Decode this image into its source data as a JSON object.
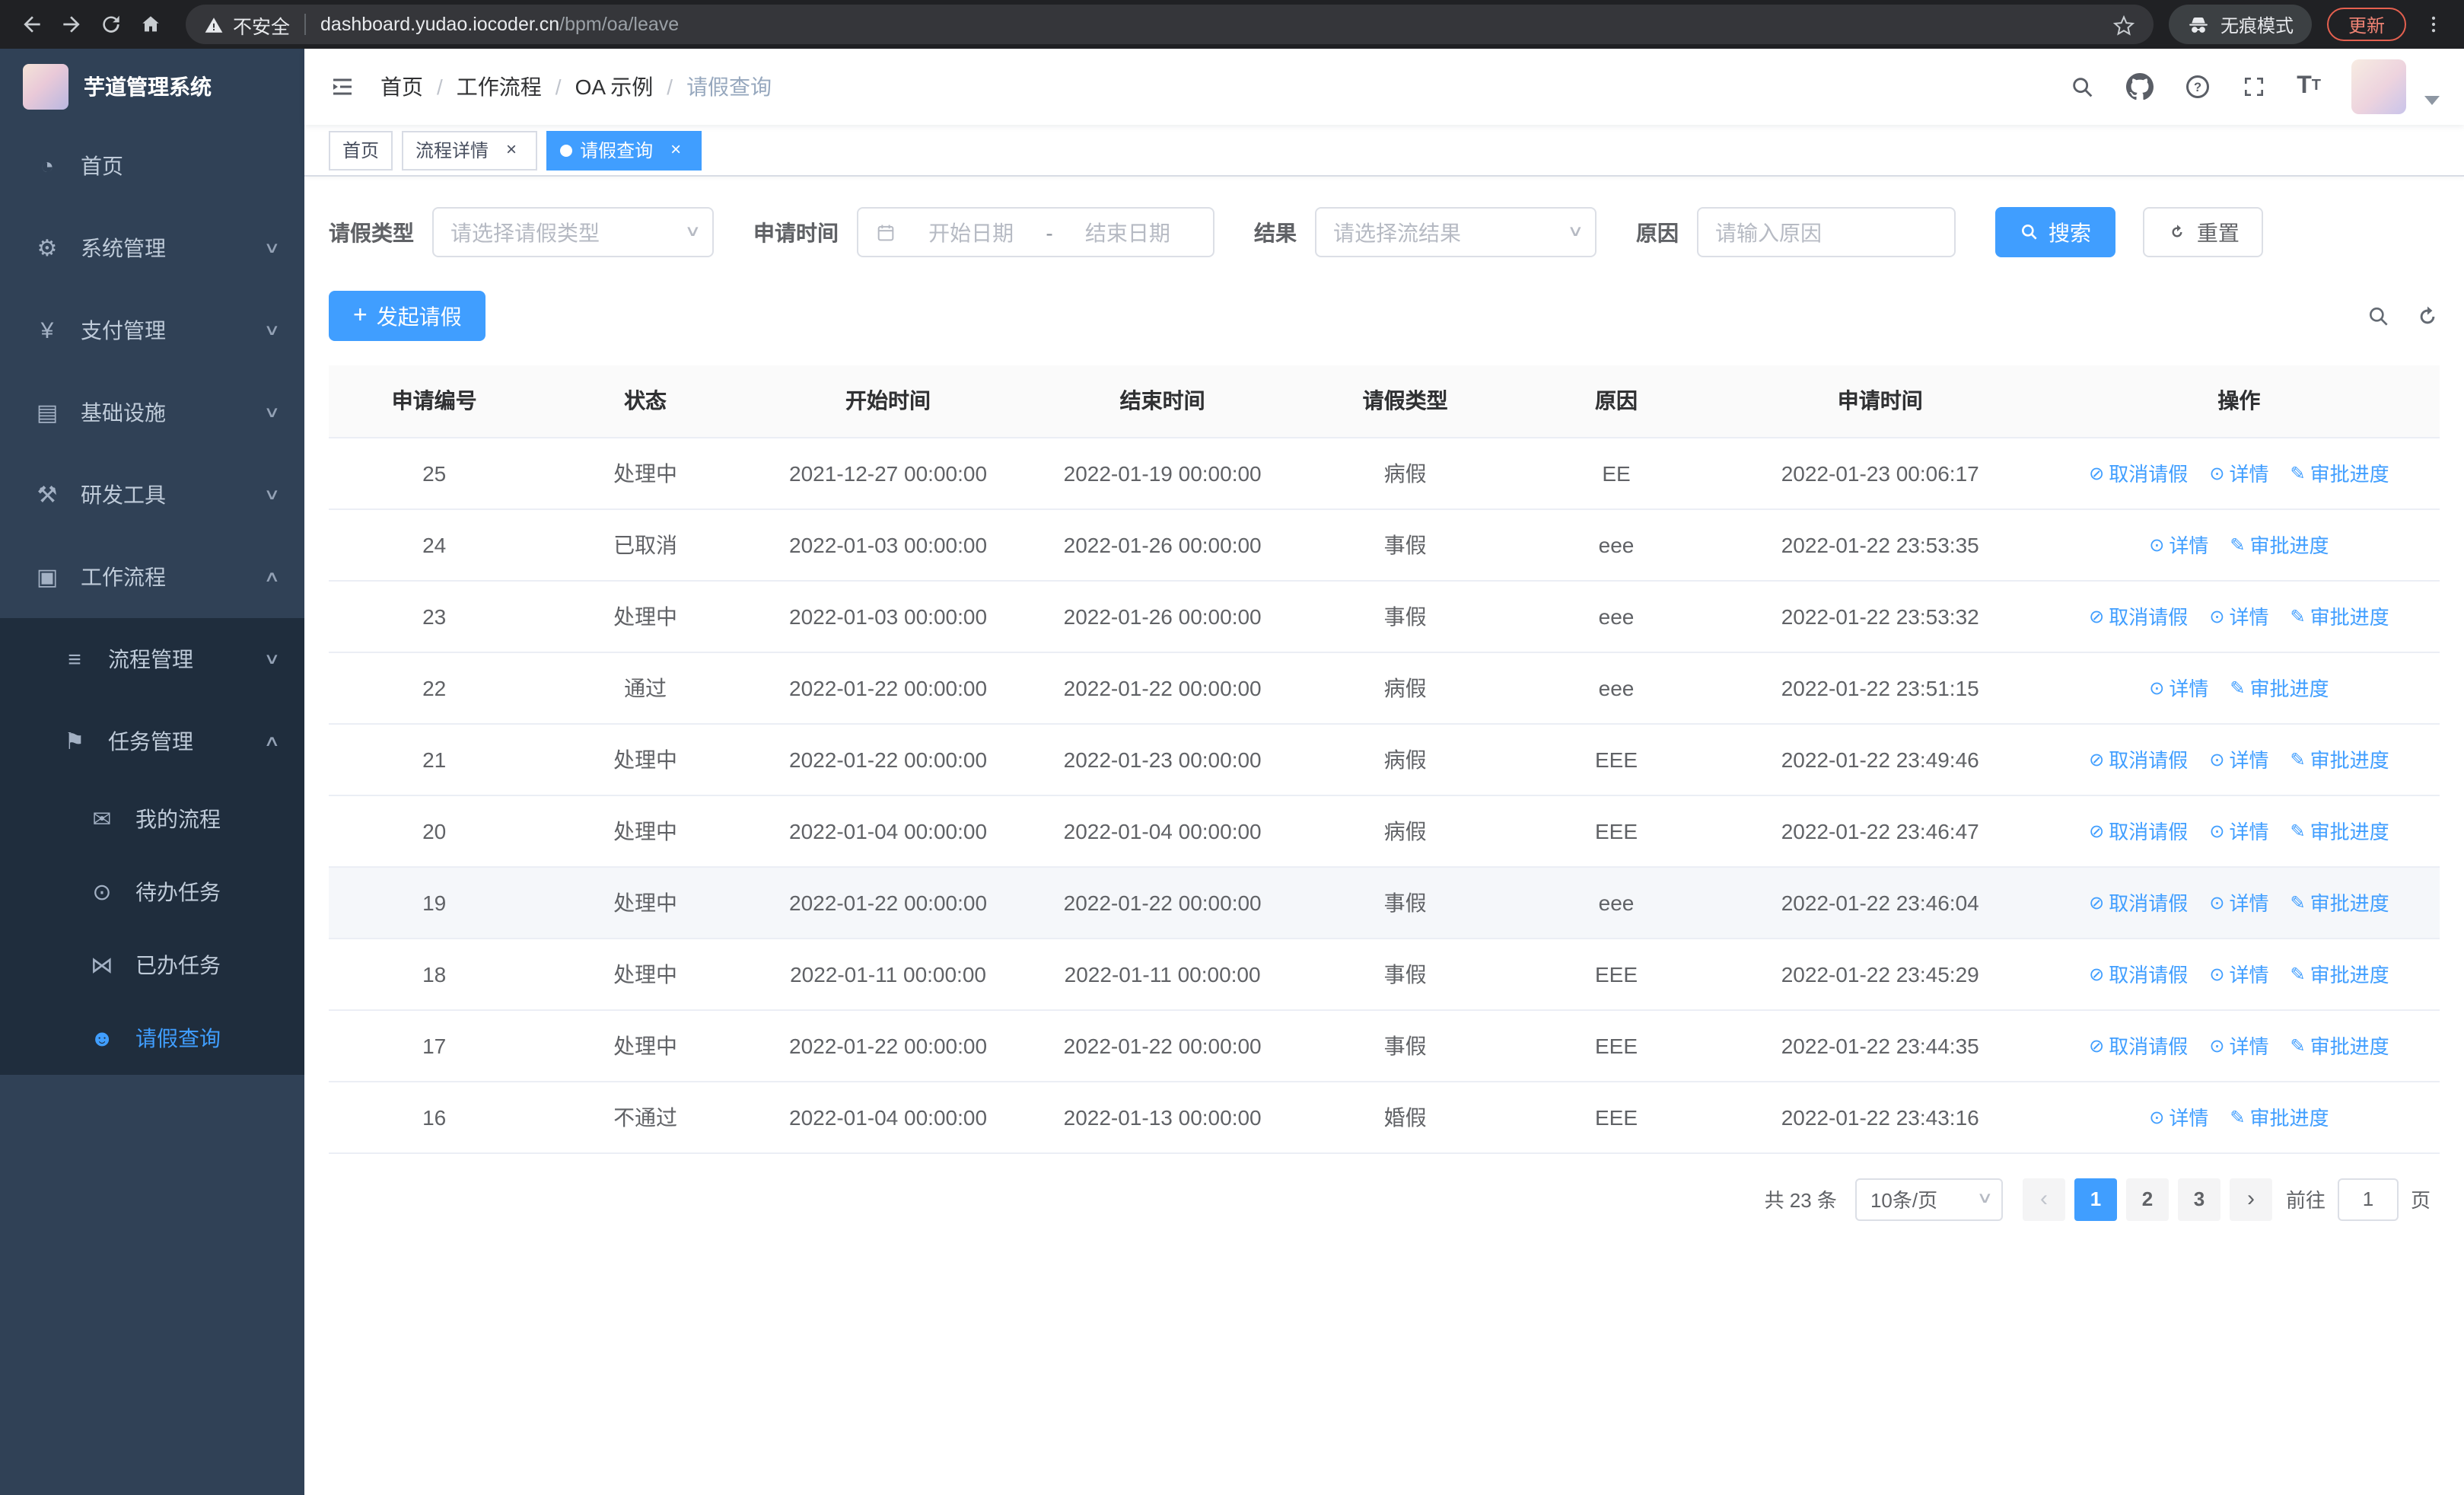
{
  "browser": {
    "security_label": "不安全",
    "url_domain": "dashboard.yudao.iocoder.cn",
    "url_path": "/bpm/oa/leave",
    "incognito_label": "无痕模式",
    "update_label": "更新"
  },
  "sidebar": {
    "logo_title": "芋道管理系统",
    "items": [
      {
        "key": "home",
        "label": "首页",
        "icon": "dashboard-icon",
        "level": 0,
        "expand": null,
        "active": false
      },
      {
        "key": "system",
        "label": "系统管理",
        "icon": "gear-icon",
        "level": 0,
        "expand": "down",
        "active": false
      },
      {
        "key": "payment",
        "label": "支付管理",
        "icon": "yen-icon",
        "level": 0,
        "expand": "down",
        "active": false
      },
      {
        "key": "infrastructure",
        "label": "基础设施",
        "icon": "monitor-icon",
        "level": 0,
        "expand": "down",
        "active": false
      },
      {
        "key": "devtools",
        "label": "研发工具",
        "icon": "briefcase-icon",
        "level": 0,
        "expand": "down",
        "active": false
      },
      {
        "key": "workflow",
        "label": "工作流程",
        "icon": "workflow-icon",
        "level": 0,
        "expand": "up",
        "active": false
      },
      {
        "key": "process-mgmt",
        "label": "流程管理",
        "icon": "list-icon",
        "level": 1,
        "expand": "down",
        "active": false
      },
      {
        "key": "task-mgmt",
        "label": "任务管理",
        "icon": "flag-icon",
        "level": 1,
        "expand": "up",
        "active": false
      },
      {
        "key": "my-process",
        "label": "我的流程",
        "icon": "chat-icon",
        "level": 2,
        "expand": null,
        "active": false
      },
      {
        "key": "todo-tasks",
        "label": "待办任务",
        "icon": "eye-icon",
        "level": 2,
        "expand": null,
        "active": false
      },
      {
        "key": "done-tasks",
        "label": "已办任务",
        "icon": "bowtie-icon",
        "level": 2,
        "expand": null,
        "active": false
      },
      {
        "key": "leave-query",
        "label": "请假查询",
        "icon": "user-icon",
        "level": 2,
        "expand": null,
        "active": true
      }
    ]
  },
  "navbar": {
    "breadcrumb": [
      "首页",
      "工作流程",
      "OA 示例",
      "请假查询"
    ]
  },
  "tabs": [
    {
      "key": "home",
      "label": "首页",
      "closable": false,
      "active": false
    },
    {
      "key": "process-detail",
      "label": "流程详情",
      "closable": true,
      "active": false
    },
    {
      "key": "leave-query",
      "label": "请假查询",
      "closable": true,
      "active": true
    }
  ],
  "filters": {
    "type_label": "请假类型",
    "type_placeholder": "请选择请假类型",
    "time_label": "申请时间",
    "time_start_placeholder": "开始日期",
    "time_separator": "-",
    "time_end_placeholder": "结束日期",
    "result_label": "结果",
    "result_placeholder": "请选择流结果",
    "reason_label": "原因",
    "reason_placeholder": "请输入原因",
    "search_label": "搜索",
    "reset_label": "重置"
  },
  "toolbar": {
    "create_label": "发起请假"
  },
  "table": {
    "columns": [
      "申请编号",
      "状态",
      "开始时间",
      "结束时间",
      "请假类型",
      "原因",
      "申请时间",
      "操作"
    ],
    "column_keys": [
      "id",
      "status",
      "start-time",
      "end-time",
      "leave-type",
      "reason",
      "apply-time",
      "actions"
    ],
    "action_labels": {
      "cancel": "取消请假",
      "detail": "详情",
      "progress": "审批进度"
    },
    "rows": [
      {
        "id": "25",
        "status": "处理中",
        "start": "2021-12-27 00:00:00",
        "end": "2022-01-19 00:00:00",
        "type": "病假",
        "reason": "EE",
        "applied": "2022-01-23 00:06:17",
        "actions": [
          "cancel",
          "detail",
          "progress"
        ],
        "highlight": false
      },
      {
        "id": "24",
        "status": "已取消",
        "start": "2022-01-03 00:00:00",
        "end": "2022-01-26 00:00:00",
        "type": "事假",
        "reason": "eee",
        "applied": "2022-01-22 23:53:35",
        "actions": [
          "detail",
          "progress"
        ],
        "highlight": false
      },
      {
        "id": "23",
        "status": "处理中",
        "start": "2022-01-03 00:00:00",
        "end": "2022-01-26 00:00:00",
        "type": "事假",
        "reason": "eee",
        "applied": "2022-01-22 23:53:32",
        "actions": [
          "cancel",
          "detail",
          "progress"
        ],
        "highlight": false
      },
      {
        "id": "22",
        "status": "通过",
        "start": "2022-01-22 00:00:00",
        "end": "2022-01-22 00:00:00",
        "type": "病假",
        "reason": "eee",
        "applied": "2022-01-22 23:51:15",
        "actions": [
          "detail",
          "progress"
        ],
        "highlight": false
      },
      {
        "id": "21",
        "status": "处理中",
        "start": "2022-01-22 00:00:00",
        "end": "2022-01-23 00:00:00",
        "type": "病假",
        "reason": "EEE",
        "applied": "2022-01-22 23:49:46",
        "actions": [
          "cancel",
          "detail",
          "progress"
        ],
        "highlight": false
      },
      {
        "id": "20",
        "status": "处理中",
        "start": "2022-01-04 00:00:00",
        "end": "2022-01-04 00:00:00",
        "type": "病假",
        "reason": "EEE",
        "applied": "2022-01-22 23:46:47",
        "actions": [
          "cancel",
          "detail",
          "progress"
        ],
        "highlight": false
      },
      {
        "id": "19",
        "status": "处理中",
        "start": "2022-01-22 00:00:00",
        "end": "2022-01-22 00:00:00",
        "type": "事假",
        "reason": "eee",
        "applied": "2022-01-22 23:46:04",
        "actions": [
          "cancel",
          "detail",
          "progress"
        ],
        "highlight": true
      },
      {
        "id": "18",
        "status": "处理中",
        "start": "2022-01-11 00:00:00",
        "end": "2022-01-11 00:00:00",
        "type": "事假",
        "reason": "EEE",
        "applied": "2022-01-22 23:45:29",
        "actions": [
          "cancel",
          "detail",
          "progress"
        ],
        "highlight": false
      },
      {
        "id": "17",
        "status": "处理中",
        "start": "2022-01-22 00:00:00",
        "end": "2022-01-22 00:00:00",
        "type": "事假",
        "reason": "EEE",
        "applied": "2022-01-22 23:44:35",
        "actions": [
          "cancel",
          "detail",
          "progress"
        ],
        "highlight": false
      },
      {
        "id": "16",
        "status": "不通过",
        "start": "2022-01-04 00:00:00",
        "end": "2022-01-13 00:00:00",
        "type": "婚假",
        "reason": "EEE",
        "applied": "2022-01-22 23:43:16",
        "actions": [
          "detail",
          "progress"
        ],
        "highlight": false
      }
    ]
  },
  "pagination": {
    "total_label": "共 23 条",
    "page_size": "10条/页",
    "prev": "‹",
    "next": "›",
    "pages": [
      "1",
      "2",
      "3"
    ],
    "active_page": "1",
    "goto_label": "前往",
    "goto_value": "1",
    "goto_suffix": "页"
  },
  "colors": {
    "primary": "#409eff",
    "sidebar_bg": "#304156",
    "submenu_bg": "#1f2d3d",
    "update_chip": "#e5604f"
  }
}
